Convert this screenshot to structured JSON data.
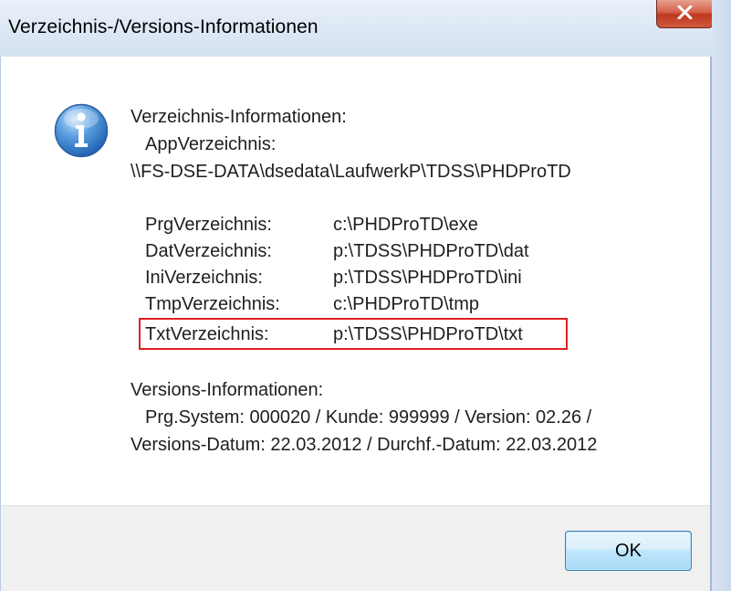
{
  "window": {
    "title": "Verzeichnis-/Versions-Informationen",
    "close_icon": "close-x-icon",
    "message_icon": "information-icon"
  },
  "directory_info": {
    "heading": "Verzeichnis-Informationen:",
    "app_label": "AppVerzeichnis:",
    "app_path": "\\\\FS-DSE-DATA\\dsedata\\LaufwerkP\\TDSS\\PHDProTD",
    "entries": [
      {
        "label": "PrgVerzeichnis:",
        "value": "c:\\PHDProTD\\exe"
      },
      {
        "label": "DatVerzeichnis:",
        "value": "p:\\TDSS\\PHDProTD\\dat"
      },
      {
        "label": "IniVerzeichnis:",
        "value": "p:\\TDSS\\PHDProTD\\ini"
      },
      {
        "label": "TmpVerzeichnis:",
        "value": "c:\\PHDProTD\\tmp"
      },
      {
        "label": "TxtVerzeichnis:",
        "value": "p:\\TDSS\\PHDProTD\\txt"
      }
    ]
  },
  "version_info": {
    "heading": "Versions-Informationen:",
    "line1": "Prg.System: 000020 / Kunde: 999999 / Version: 02.26 /",
    "line2": "Versions-Datum: 22.03.2012 / Durchf.-Datum: 22.03.2012"
  },
  "buttons": {
    "ok_label": "OK"
  },
  "colors": {
    "highlight_border": "#e02020",
    "titlebar": "#dde8f5",
    "ok_button_border": "#3c7fb1",
    "close_button": "#c7482f"
  }
}
